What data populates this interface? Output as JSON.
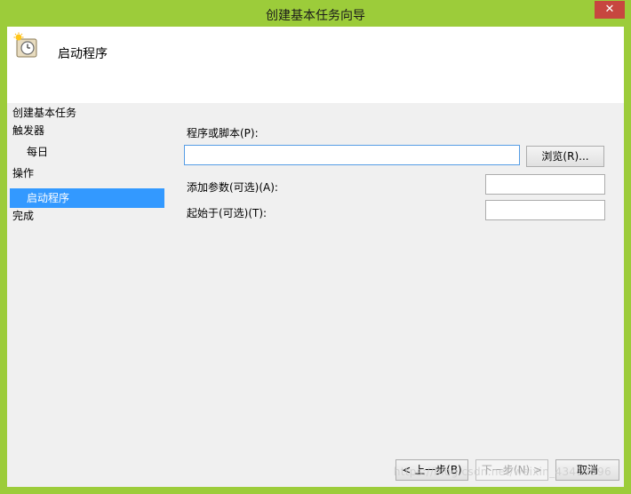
{
  "window": {
    "title": "创建基本任务向导",
    "close_glyph": "✕"
  },
  "header": {
    "title": "启动程序",
    "icon": "scheduled-task-clock-icon"
  },
  "nav": {
    "items": [
      {
        "label": "创建基本任务"
      },
      {
        "label": "触发器"
      },
      {
        "label": "每日"
      },
      {
        "label": "操作"
      },
      {
        "label": "启动程序"
      },
      {
        "label": "完成"
      }
    ]
  },
  "form": {
    "program_label": "程序或脚本(P):",
    "program_value": "",
    "browse_label": "浏览(R)...",
    "args_label": "添加参数(可选)(A):",
    "args_value": "",
    "start_in_label": "起始于(可选)(T):",
    "start_in_value": ""
  },
  "footer": {
    "back_label": "< 上一步(B)",
    "next_label": "下一步(N) >",
    "cancel_label": "取消"
  },
  "watermark": "https://blog.csdn.net/weixin_43419596",
  "colors": {
    "accent": "#9ccc3a",
    "selection": "#3399ff",
    "close": "#c7463f"
  }
}
